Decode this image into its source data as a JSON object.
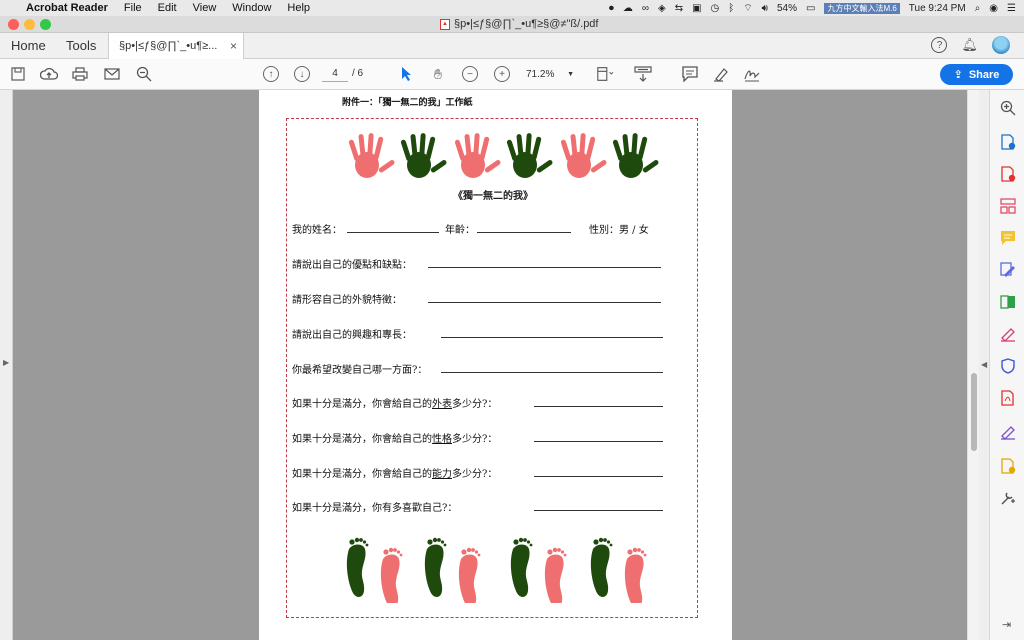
{
  "menubar": {
    "app_name": "Acrobat Reader",
    "items": [
      "File",
      "Edit",
      "View",
      "Window",
      "Help"
    ],
    "battery": "54%",
    "ime": "九方中文輸入法M.6",
    "clock": "Tue 9:24 PM"
  },
  "window": {
    "title": "§p•|≤ƒ§@∏`_•u¶≥§@≠\"ß/.pdf"
  },
  "tabs": {
    "home": "Home",
    "tools": "Tools",
    "document": "§p•|≤ƒ§@∏`_•u¶≥...",
    "close": "×"
  },
  "toolbar": {
    "page_current": "4",
    "page_total": "/ 6",
    "zoom": "71.2%",
    "share": "Share"
  },
  "document": {
    "attachment_title": "附件一：「獨一無二的我」工作紙",
    "worksheet_title": "《獨一無二的我》",
    "name_label": "我的姓名：",
    "age_label": "年齡：",
    "gender_label": "性別：男 / 女",
    "q1": "請說出自己的優點和缺點：",
    "q2": "請形容自己的外貌特徵：",
    "q3": "請說出自己的興趣和專長：",
    "q4": "你最希望改變自己哪一方面?：",
    "score_prefix": "如果十分是滿分，你會給自己的",
    "score_suffix": "多少分?：",
    "q5_key": "外表",
    "q6_key": "性格",
    "q7_key": "能力",
    "q8": "如果十分是滿分，你有多喜歡自己?："
  },
  "colors": {
    "hand_pink": "#ef6f70",
    "hand_green": "#1f4a0d",
    "border": "#c03a47",
    "share": "#1473e6"
  }
}
